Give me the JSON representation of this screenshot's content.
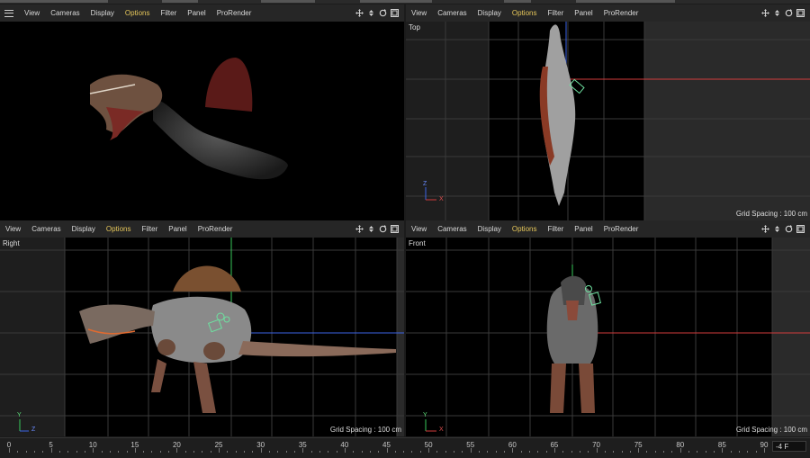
{
  "menu": [
    "View",
    "Cameras",
    "Display",
    "Options",
    "Filter",
    "Panel",
    "ProRender"
  ],
  "active_menu": "Options",
  "viewports": {
    "perspective": {
      "label": "",
      "grid": ""
    },
    "top": {
      "label": "Top",
      "grid": "Grid Spacing : 100 cm"
    },
    "right": {
      "label": "Right",
      "grid": "Grid Spacing : 100 cm"
    },
    "front": {
      "label": "Front",
      "grid": "Grid Spacing : 100 cm"
    }
  },
  "axis_labels": {
    "y": "Y",
    "z": "Z",
    "x": "X"
  },
  "timeline": {
    "ticks": [
      "0",
      "5",
      "10",
      "15",
      "20",
      "25",
      "30",
      "35",
      "40",
      "45",
      "50",
      "55",
      "60",
      "65",
      "70",
      "75",
      "80",
      "85",
      "90"
    ],
    "frame_field": "-4 F"
  },
  "colors": {
    "active_menu": "#e5c65a",
    "grid": "#3a3a3a",
    "axis_x": "#d23c3c",
    "axis_y": "#37c85a",
    "axis_z": "#3c64e6"
  }
}
